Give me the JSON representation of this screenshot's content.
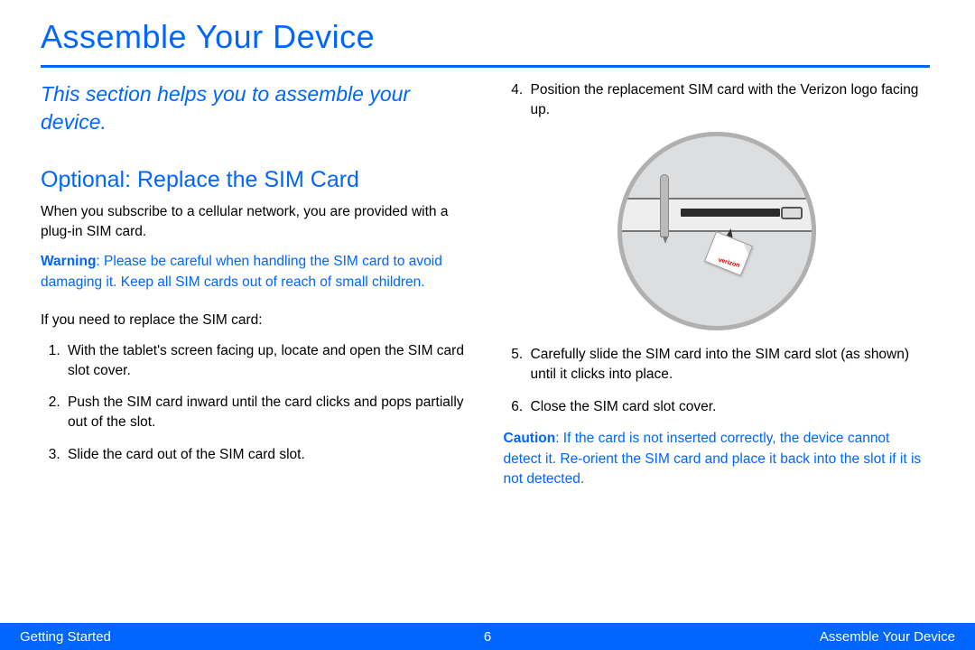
{
  "title": "Assemble Your Device",
  "intro": "This section helps you to assemble your device.",
  "section_heading": "Optional: Replace the SIM Card",
  "lead_text": "When you subscribe to a cellular network, you are provided with a plug-in SIM card.",
  "warning_label": "Warning",
  "warning_text": ": Please be careful when handling the SIM card to avoid damaging it. Keep all SIM cards out of reach of small children.",
  "replace_intro": "If you need to replace the SIM card:",
  "steps_left": [
    "With the tablet's screen facing up, locate and open the SIM card slot cover.",
    "Push the SIM card inward until the card clicks and pops partially out of the slot.",
    "Slide the card out of the SIM card slot."
  ],
  "steps_right_4": "Position the replacement SIM card with the Verizon logo facing up.",
  "steps_right_5": "Carefully slide the SIM card into the SIM card slot (as shown) until it clicks into place.",
  "steps_right_6": "Close the SIM card slot cover.",
  "caution_label": "Caution",
  "caution_text": ": If the card is not inserted correctly, the device cannot detect it. Re-orient the SIM card and place it back into the slot if it is not detected.",
  "sim_logo_text": "verizon",
  "footer": {
    "left": "Getting Started",
    "page": "6",
    "right": "Assemble Your Device"
  }
}
